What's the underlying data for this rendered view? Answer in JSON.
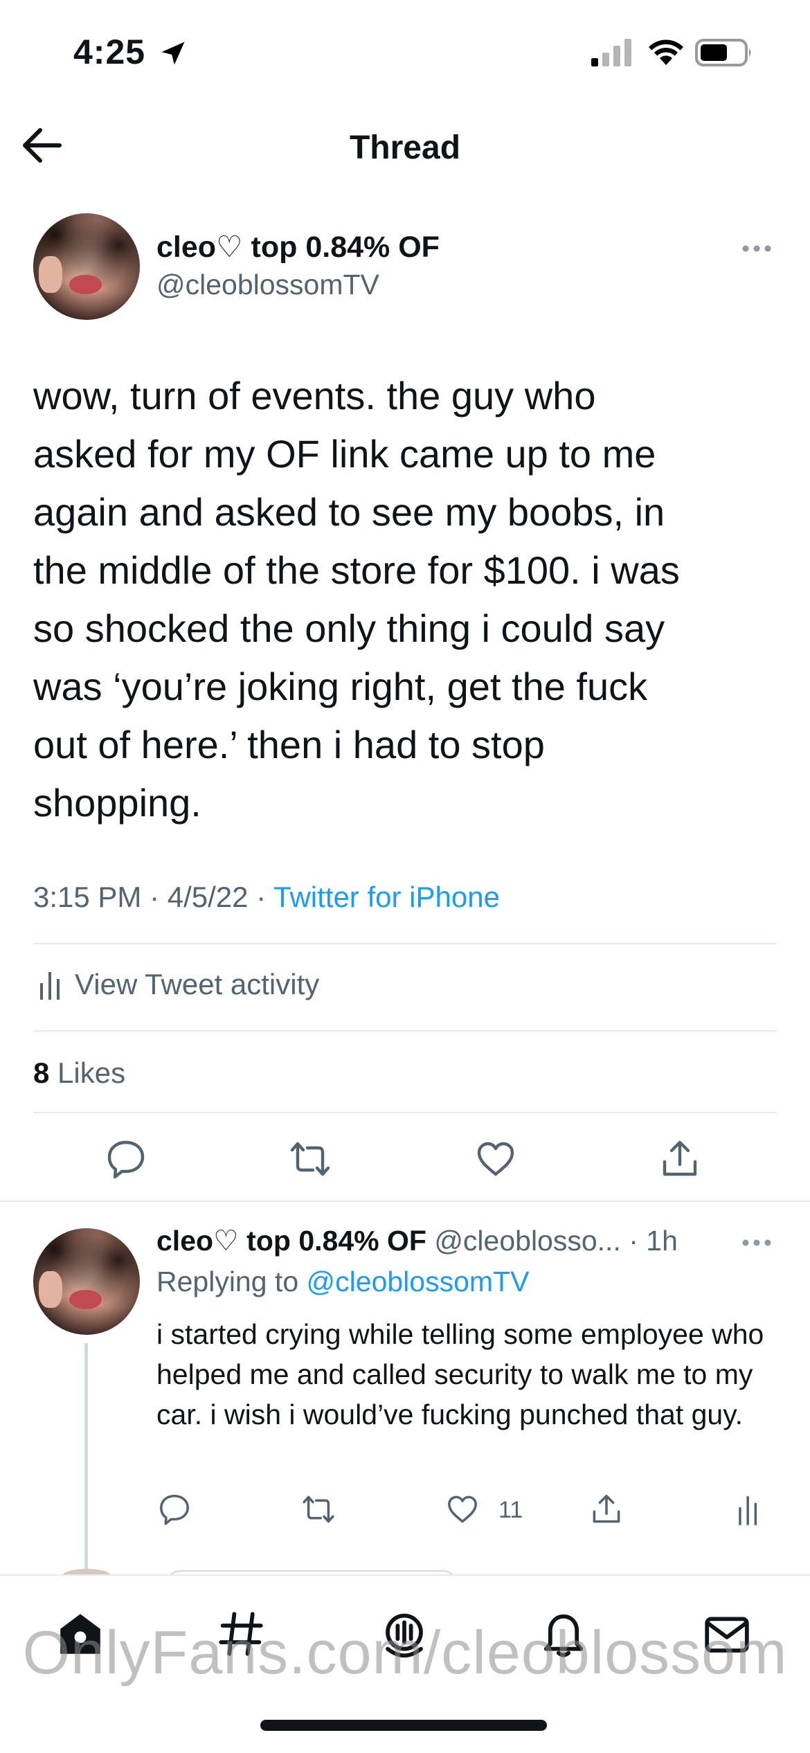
{
  "status_bar": {
    "time": "4:25"
  },
  "nav": {
    "title": "Thread"
  },
  "main_tweet": {
    "display_name": "cleo♡ top 0.84% OF",
    "handle": "@cleoblossomTV",
    "text": "wow, turn of events. the guy who\nasked for my OF link came up to me\nagain and asked to see my boobs, in\nthe middle of the store for $100. i was\nso shocked the only thing i could say\nwas ‘you’re joking right, get the fuck\nout of here.’ then i had to stop\nshopping.",
    "time": "3:15 PM",
    "date": "4/5/22",
    "separator": " · ",
    "source": "Twitter for iPhone",
    "activity_label": "View Tweet activity",
    "likes_count": "8",
    "likes_label": "Likes"
  },
  "reply_tweet": {
    "display_name": "cleo♡ top 0.84% OF",
    "handle": "@cleoblosso...",
    "time": "· 1h",
    "replying_prefix": "Replying to",
    "replying_to": "@cleoblossomTV",
    "text": "i started crying while telling some employee who helped me and called security to walk me to my car. i wish i would’ve fucking punched that guy.",
    "like_count": "11"
  },
  "watermark": "OnlyFans.com/cleoblossom",
  "colors": {
    "accent": "#1d9bf0",
    "secondary_text": "#536471",
    "primary_text": "#0f1419",
    "divider": "#e6ebee"
  },
  "icons": {
    "tab_bar": [
      "home-icon",
      "explore-hash-icon",
      "spaces-icon",
      "notifications-bell-icon",
      "messages-envelope-icon"
    ],
    "actions": [
      "reply-icon",
      "retweet-icon",
      "like-heart-icon",
      "share-icon",
      "activity-icon"
    ]
  }
}
